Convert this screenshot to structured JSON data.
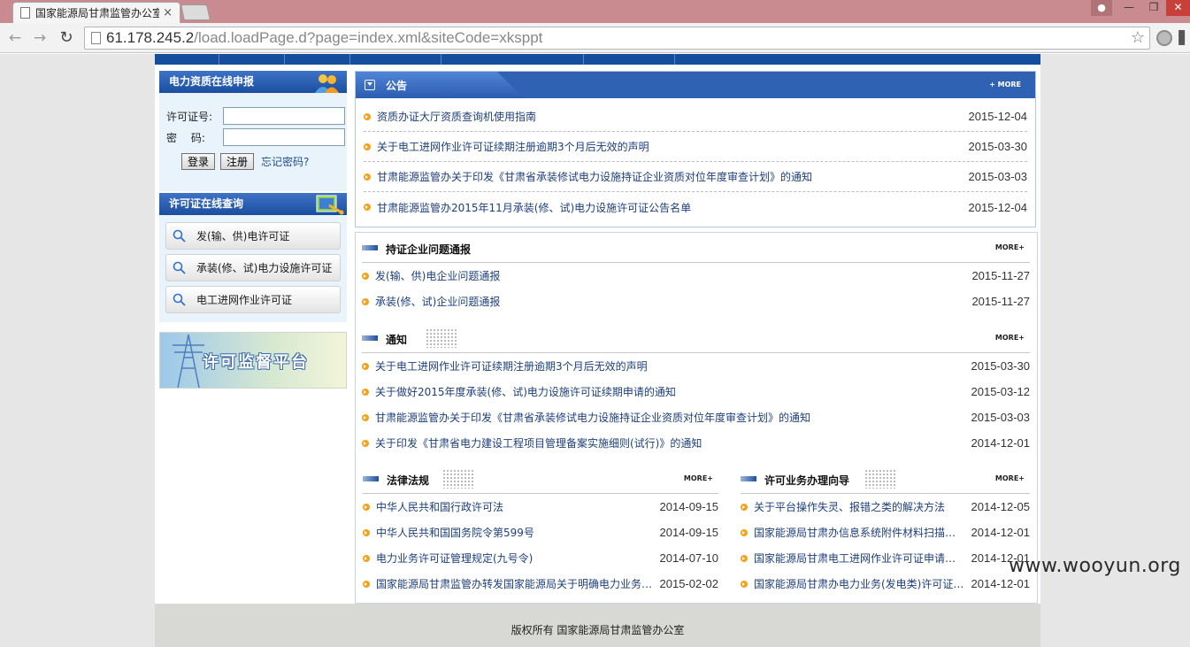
{
  "browser": {
    "tab_title": "国家能源局甘肃监管办公室",
    "tab_close": "×",
    "url_host": "61.178.245.2",
    "url_path": "/load.loadPage.d?page=index.xml&siteCode=xksppt",
    "window_min": "—",
    "window_max": "❐",
    "window_close": "✕"
  },
  "sidebar": {
    "login": {
      "title": "电力资质在线申报",
      "license_label": "许可证号:",
      "license_value": "",
      "password_label": "密　 码:",
      "password_value": "",
      "login_button": "登录",
      "register_button": "注册",
      "forgot_link": "忘记密码?"
    },
    "query": {
      "title": "许可证在线查询",
      "items": [
        {
          "label": "发(输、供)电许可证"
        },
        {
          "label": "承装(修、试)电力设施许可证"
        },
        {
          "label": "电工进网作业许可证"
        }
      ]
    },
    "banner_text": "许可监督平台"
  },
  "notice": {
    "title": "公告",
    "more": "+ MORE",
    "items": [
      {
        "title": "资质办证大厅资质查询机使用指南",
        "date": "2015-12-04"
      },
      {
        "title": "关于电工进网作业许可证续期注册逾期3个月后无效的声明",
        "date": "2015-03-30"
      },
      {
        "title": "甘肃能源监管办关于印发《甘肃省承装修试电力设施持证企业资质对位年度审查计划》的通知",
        "date": "2015-03-03"
      },
      {
        "title": "甘肃能源监管办2015年11月承装(修、试)电力设施许可证公告名单",
        "date": "2015-12-04"
      }
    ]
  },
  "sections": {
    "problems": {
      "title": "持证企业问题通报",
      "more": "MORE+",
      "items": [
        {
          "title": "发(输、供)电企业问题通报",
          "date": "2015-11-27"
        },
        {
          "title": "承装(修、试)企业问题通报",
          "date": "2015-11-27"
        }
      ]
    },
    "notify": {
      "title": "通知",
      "more": "MORE+",
      "items": [
        {
          "title": "关于电工进网作业许可证续期注册逾期3个月后无效的声明",
          "date": "2015-03-30"
        },
        {
          "title": "关于做好2015年度承装(修、试)电力设施许可证续期申请的通知",
          "date": "2015-03-12"
        },
        {
          "title": "甘肃能源监管办关于印发《甘肃省承装修试电力设施持证企业资质对位年度审查计划》的通知",
          "date": "2015-03-03"
        },
        {
          "title": "关于印发《甘肃省电力建设工程项目管理备案实施细则(试行)》的通知",
          "date": "2014-12-01"
        }
      ]
    },
    "law": {
      "title": "法律法规",
      "more": "MORE+",
      "items": [
        {
          "title": "中华人民共和国行政许可法",
          "date": "2014-09-15"
        },
        {
          "title": "中华人民共和国国务院令第599号",
          "date": "2014-09-15"
        },
        {
          "title": "电力业务许可证管理规定(九号令)",
          "date": "2014-07-10"
        },
        {
          "title": "国家能源局甘肃监管办转发国家能源局关于明确电力业务许可管理有关事项的通知",
          "date": "2015-02-02"
        }
      ]
    },
    "guide": {
      "title": "许可业务办理向导",
      "more": "MORE+",
      "items": [
        {
          "title": "关于平台操作失灵、报错之类的解决方法",
          "date": "2014-12-05"
        },
        {
          "title": "国家能源局甘肃办信息系统附件材料扫描要求说明",
          "date": "2014-12-01"
        },
        {
          "title": "国家能源局甘肃电工进网作业许可证申请流程说明",
          "date": "2014-12-01"
        },
        {
          "title": "国家能源局甘肃办电力业务(发电类)许可证申请流程",
          "date": "2014-12-01"
        }
      ]
    }
  },
  "footer": {
    "copyright": "版权所有 国家能源局甘肃监管办公室"
  },
  "watermark": "www.wooyun.org"
}
